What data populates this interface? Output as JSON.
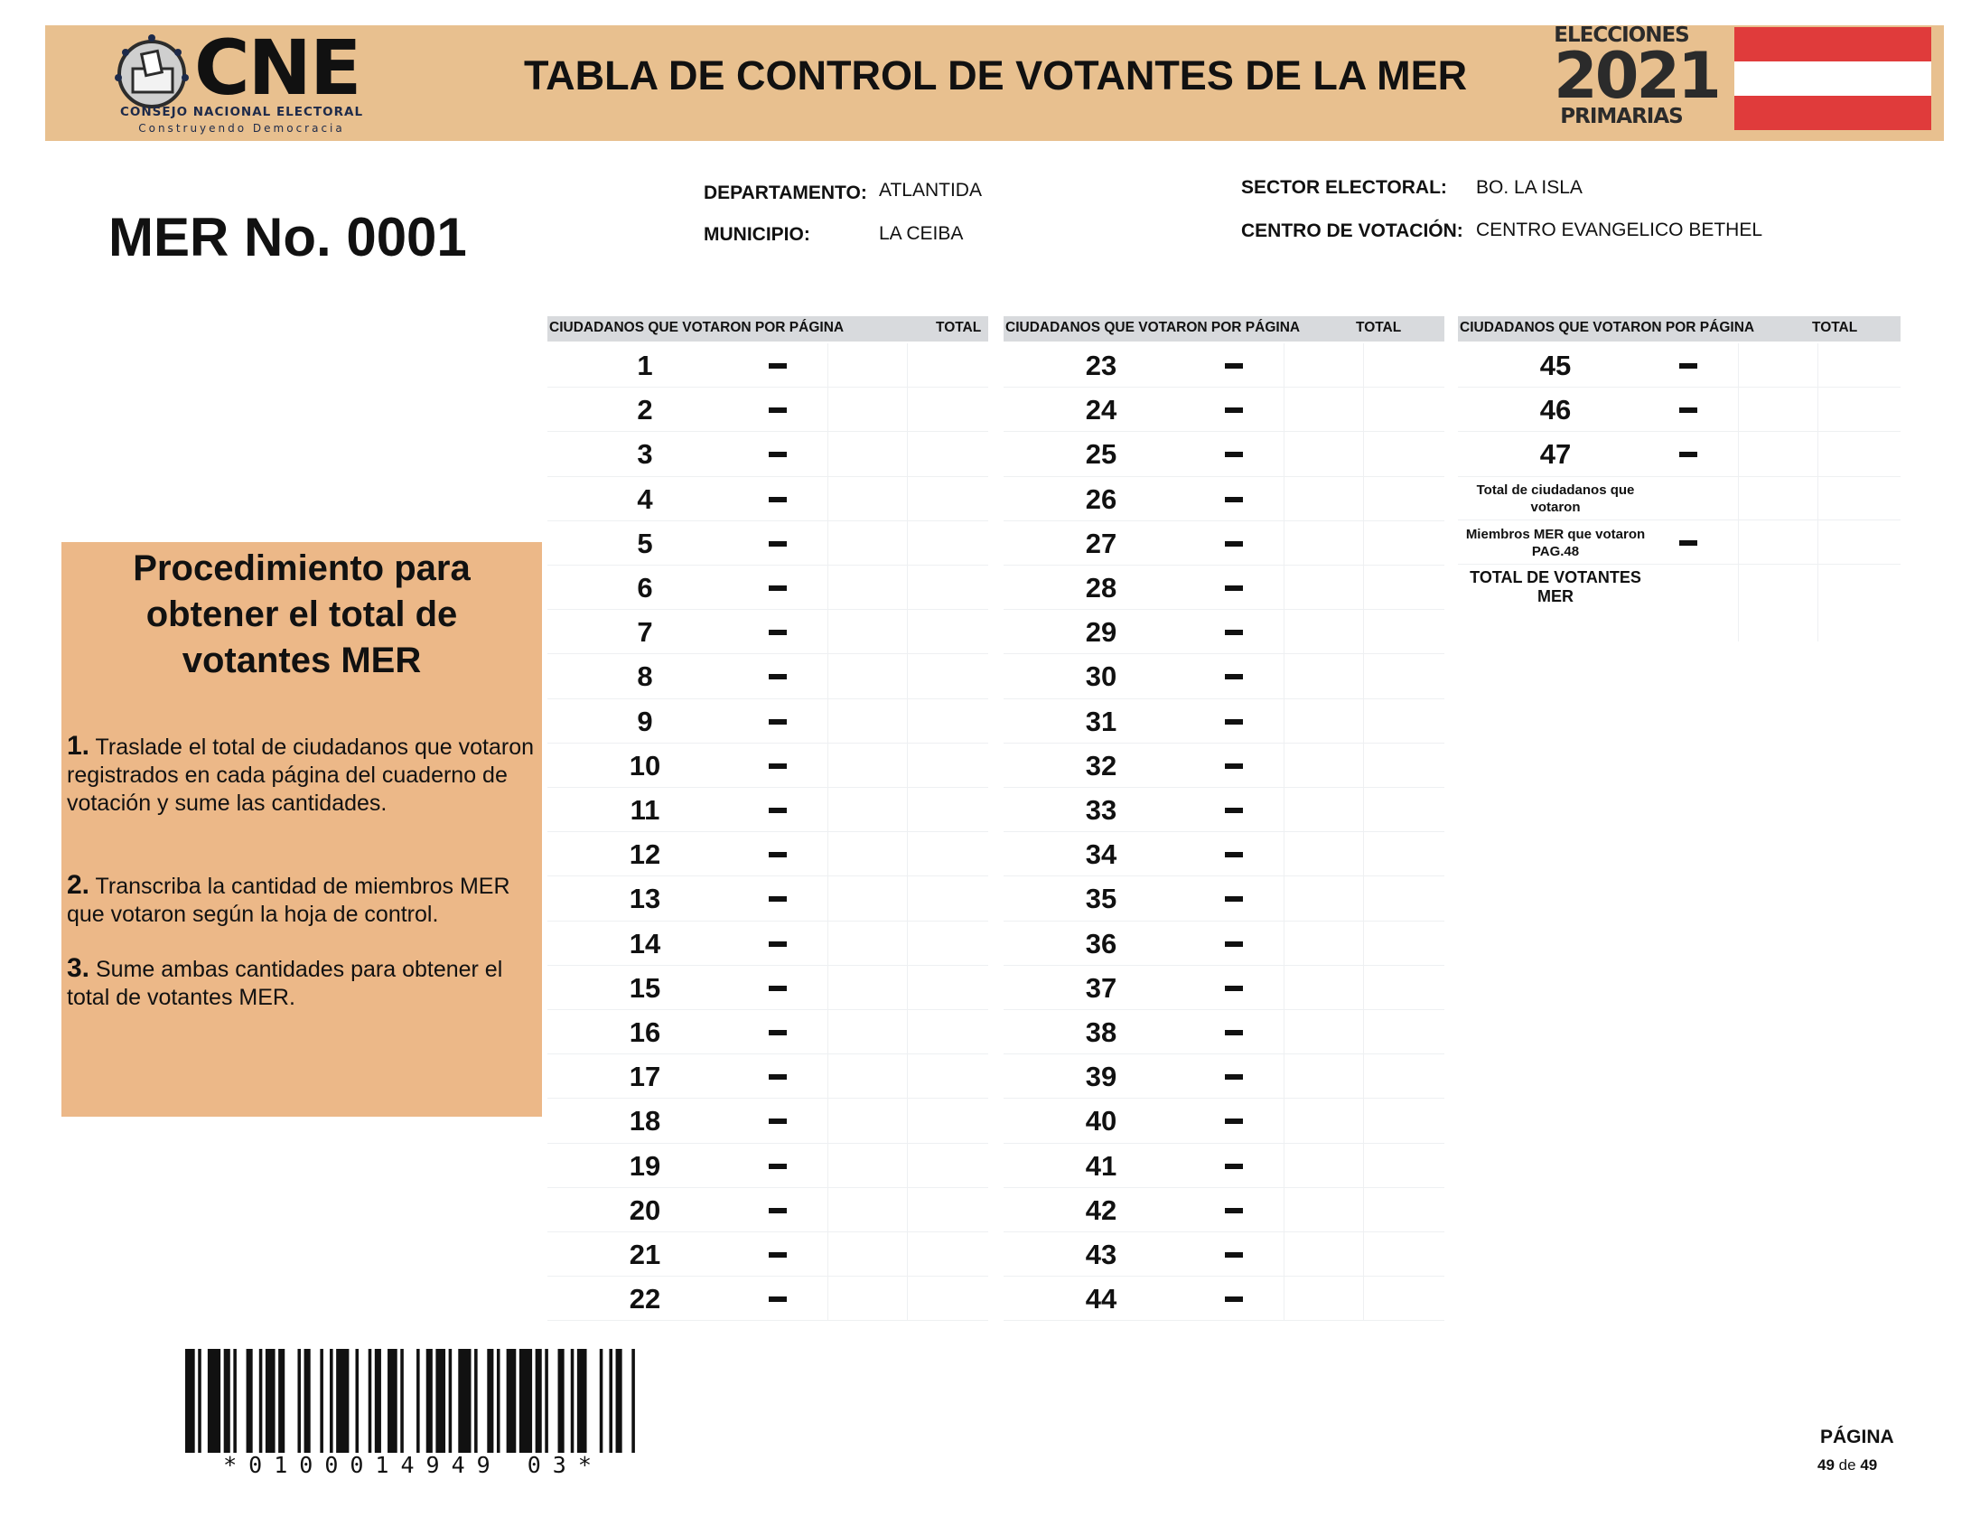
{
  "header": {
    "logo_text": "CNE",
    "logo_subtitle": "CONSEJO NACIONAL ELECTORAL",
    "logo_tagline": "Construyendo Democracia",
    "title": "TABLA DE CONTROL DE VOTANTES DE LA MER",
    "badge_top": "ELECCIONES",
    "badge_year": "2021",
    "badge_bottom": "PRIMARIAS",
    "flag_colors": [
      "#e03b3b",
      "#ffffff",
      "#e03b3b"
    ]
  },
  "mer_number": "MER No. 0001",
  "location": {
    "departamento_label": "DEPARTAMENTO:",
    "departamento": "ATLANTIDA",
    "municipio_label": "MUNICIPIO:",
    "municipio": "LA CEIBA",
    "sector_label": "SECTOR ELECTORAL:",
    "sector": "BO. LA ISLA",
    "centro_label": "CENTRO DE VOTACIÓN:",
    "centro": "CENTRO EVANGELICO BETHEL"
  },
  "procedure": {
    "title": "Procedimiento para obtener el total de votantes MER",
    "steps": [
      {
        "num": "1.",
        "text": "Traslade el total de ciudadanos que votaron registrados en cada página del cuaderno de votación y sume las cantidades."
      },
      {
        "num": "2.",
        "text": "Transcriba la cantidad de miembros MER que votaron según la hoja de control."
      },
      {
        "num": "3.",
        "text": "Sume ambas cantidades para obtener el total de votantes MER."
      }
    ]
  },
  "table": {
    "columns": [
      {
        "header_label": "CIUDADANOS  QUE VOTARON POR PÁGINA",
        "header_total": "TOTAL",
        "pages": [
          "1",
          "2",
          "3",
          "4",
          "5",
          "6",
          "7",
          "8",
          "9",
          "10",
          "11",
          "12",
          "13",
          "14",
          "15",
          "16",
          "17",
          "18",
          "19",
          "20",
          "21",
          "22"
        ]
      },
      {
        "header_label": "CIUDADANOS QUE VOTARON POR PÁGINA",
        "header_total": "TOTAL",
        "pages": [
          "23",
          "24",
          "25",
          "26",
          "27",
          "28",
          "29",
          "30",
          "31",
          "32",
          "33",
          "34",
          "35",
          "36",
          "37",
          "38",
          "39",
          "40",
          "41",
          "42",
          "43",
          "44"
        ]
      },
      {
        "header_label": "CIUDADANOS QUE VOTARON POR PÁGINA",
        "header_total": "TOTAL",
        "pages": [
          "45",
          "46",
          "47"
        ]
      }
    ],
    "summary": {
      "total_ciudadanos": "Total de ciudadanos que votaron",
      "miembros_mer": "Miembros MER que votaron PAG.48",
      "total_votantes": "TOTAL DE VOTANTES MER"
    }
  },
  "barcode_text": "*0100014949 03*",
  "page": {
    "label": "PÁGINA",
    "current": "49",
    "of": "de",
    "total": "49"
  }
}
